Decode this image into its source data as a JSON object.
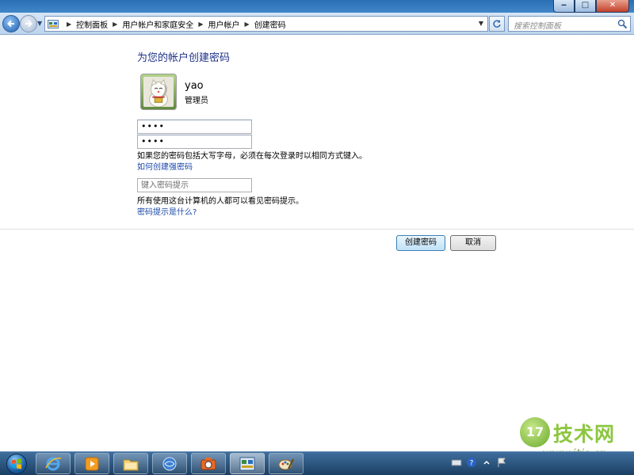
{
  "window": {
    "buttons": {
      "minimize": "‒",
      "maximize": "□",
      "close": "✕"
    }
  },
  "navbar": {
    "breadcrumbs": [
      "控制面板",
      "用户帐户和家庭安全",
      "用户帐户",
      "创建密码"
    ],
    "separator": "▶",
    "search_placeholder": "搜索控制面板"
  },
  "main": {
    "title": "为您的帐户创建密码",
    "user": {
      "name": "yao",
      "role": "管理员"
    },
    "password_value": "••••",
    "confirm_value": "••••",
    "case_note": "如果您的密码包括大写字母，必须在每次登录时以相同方式键入。",
    "strong_link": "如何创建强密码",
    "hint_placeholder": "键入密码提示",
    "hint_note": "所有使用这台计算机的人都可以看见密码提示。",
    "hint_link": "密码提示是什么?",
    "create_button": "创建密码",
    "cancel_button": "取消"
  },
  "watermark": {
    "badge": "17",
    "text": "技术网",
    "url": "www.itjs.cn"
  },
  "taskbar": {
    "apps": [
      "internet-explorer-icon",
      "media-player-icon",
      "file-explorer-icon",
      "network-icon",
      "camera-app-icon",
      "control-panel-icon",
      "paint-icon"
    ],
    "active_app": "control-panel-icon"
  },
  "colors": {
    "title_blue": "#1e3287",
    "link_blue": "#1a47a8",
    "watermark_green": "#8cc63f"
  }
}
